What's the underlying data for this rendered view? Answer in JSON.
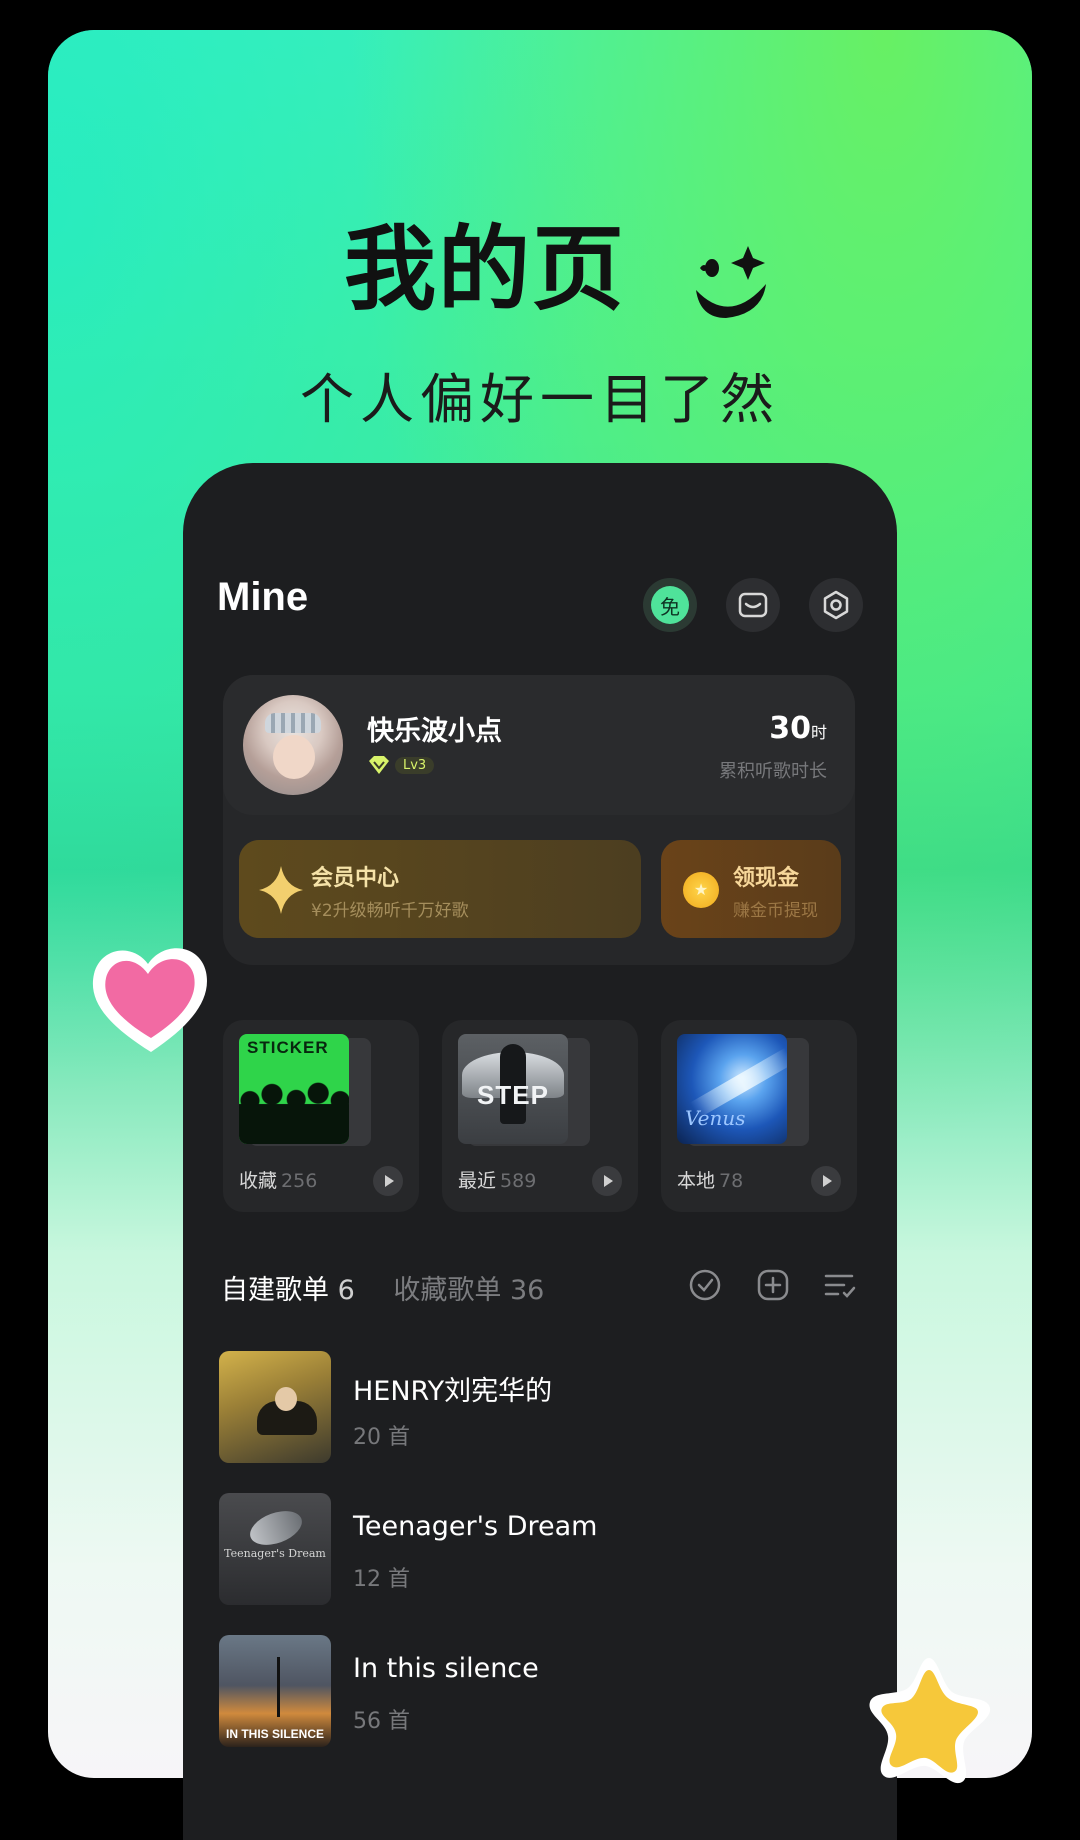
{
  "hero": {
    "title": "我的页",
    "subtitle": "个人偏好一目了然"
  },
  "app": {
    "page_title": "Mine",
    "free_badge": "免"
  },
  "profile": {
    "username": "快乐波小点",
    "level": "Lv3",
    "hours_value": "30",
    "hours_unit": "时",
    "hours_label": "累积听歌时长"
  },
  "vip": {
    "title": "会员中心",
    "subtitle": "¥2升级畅听千万好歌"
  },
  "cash": {
    "title": "领现金",
    "subtitle": "赚金币提现"
  },
  "tiles": [
    {
      "label": "收藏",
      "count": "256",
      "cover_text": "STICKER"
    },
    {
      "label": "最近",
      "count": "589",
      "cover_text": "STEP"
    },
    {
      "label": "本地",
      "count": "78",
      "cover_text": "Venus"
    }
  ],
  "tabs": {
    "created_label": "自建歌单",
    "created_count": "6",
    "collected_label": "收藏歌单",
    "collected_count": "36"
  },
  "playlists": [
    {
      "name": "HENRY刘宪华的",
      "count": "20 首"
    },
    {
      "name": "Teenager's Dream",
      "count": "12 首",
      "cover_text": "Teenager's Dream"
    },
    {
      "name": "In this silence",
      "count": "56 首",
      "cover_text": "IN THIS SILENCE"
    }
  ],
  "colors": {
    "accent_green": "#4fe39a",
    "phone_bg": "#1d1e20",
    "vip_gold": "#f5e2a8"
  },
  "icons": [
    "smile-sparkle-icon",
    "mail-icon",
    "settings-icon",
    "sparkle-icon",
    "coin-icon",
    "play-icon",
    "locate-icon",
    "add-icon",
    "sort-icon",
    "heart-icon",
    "star-icon"
  ]
}
